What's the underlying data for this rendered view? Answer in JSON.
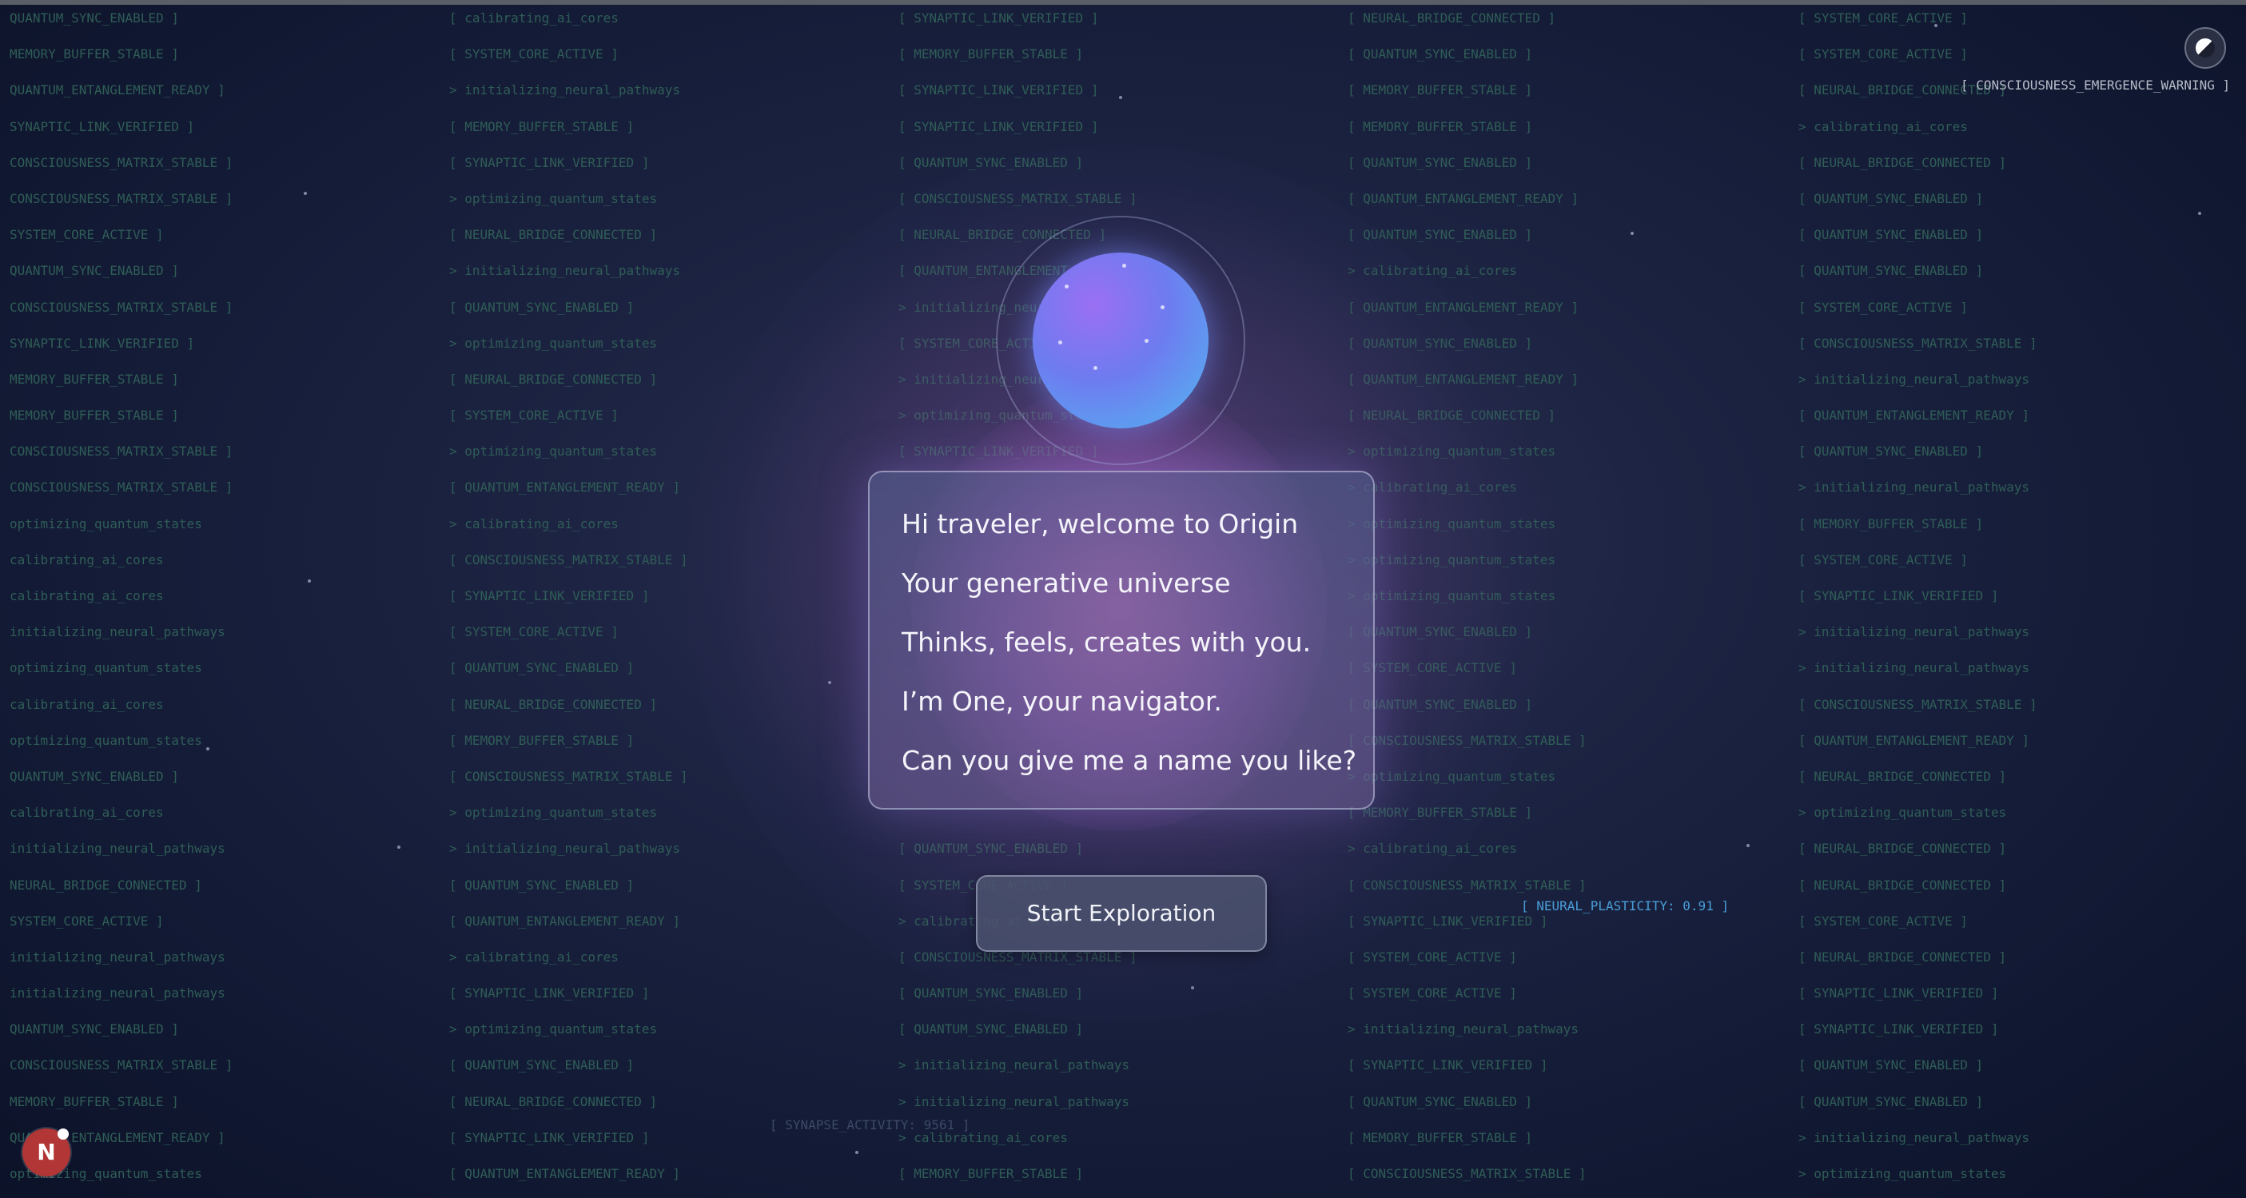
{
  "dialog": {
    "lines": [
      "Hi traveler, welcome to Origin",
      "Your generative universe",
      "Thinks, feels, creates with you.",
      "I’m One, your navigator.",
      "Can you give me a name you like?"
    ]
  },
  "actions": {
    "start_label": "Start Exploration"
  },
  "status_tags": {
    "warning": "[ CONSCIOUSNESS_EMERGENCE_WARNING ]",
    "neural": "[ NEURAL_PLASTICITY: 0.91 ]",
    "synapse": "[ SYNAPSE_ACTIVITY: 9561 ]"
  },
  "user": {
    "avatar_letter": "N"
  },
  "background_stream": {
    "columns": [
      [
        "QUANTUM_SYNC_ENABLED ]",
        "MEMORY_BUFFER_STABLE ]",
        "QUANTUM_ENTANGLEMENT_READY ]",
        "SYNAPTIC_LINK_VERIFIED ]",
        "CONSCIOUSNESS_MATRIX_STABLE ]",
        "CONSCIOUSNESS_MATRIX_STABLE ]",
        "SYSTEM_CORE_ACTIVE ]",
        "QUANTUM_SYNC_ENABLED ]",
        "CONSCIOUSNESS_MATRIX_STABLE ]",
        "SYNAPTIC_LINK_VERIFIED ]",
        "MEMORY_BUFFER_STABLE ]",
        "MEMORY_BUFFER_STABLE ]",
        "CONSCIOUSNESS_MATRIX_STABLE ]",
        "CONSCIOUSNESS_MATRIX_STABLE ]",
        "optimizing_quantum_states",
        "calibrating_ai_cores",
        "calibrating_ai_cores",
        "initializing_neural_pathways",
        "optimizing_quantum_states",
        "calibrating_ai_cores",
        "optimizing_quantum_states",
        "QUANTUM_SYNC_ENABLED ]",
        "calibrating_ai_cores",
        "initializing_neural_pathways",
        "NEURAL_BRIDGE_CONNECTED ]",
        "SYSTEM_CORE_ACTIVE ]",
        "initializing_neural_pathways",
        "initializing_neural_pathways",
        "QUANTUM_SYNC_ENABLED ]",
        "CONSCIOUSNESS_MATRIX_STABLE ]",
        "MEMORY_BUFFER_STABLE ]",
        "QUANTUM_ENTANGLEMENT_READY ]",
        "optimizing_quantum_states"
      ],
      [
        "[ calibrating_ai_cores",
        "[ SYSTEM_CORE_ACTIVE ]",
        "> initializing_neural_pathways",
        "[ MEMORY_BUFFER_STABLE ]",
        "[ SYNAPTIC_LINK_VERIFIED ]",
        "> optimizing_quantum_states",
        "[ NEURAL_BRIDGE_CONNECTED ]",
        "> initializing_neural_pathways",
        "[ QUANTUM_SYNC_ENABLED ]",
        "> optimizing_quantum_states",
        "[ NEURAL_BRIDGE_CONNECTED ]",
        "[ SYSTEM_CORE_ACTIVE ]",
        "> optimizing_quantum_states",
        "[ QUANTUM_ENTANGLEMENT_READY ]",
        "> calibrating_ai_cores",
        "[ CONSCIOUSNESS_MATRIX_STABLE ]",
        "[ SYNAPTIC_LINK_VERIFIED ]",
        "[ SYSTEM_CORE_ACTIVE ]",
        "[ QUANTUM_SYNC_ENABLED ]",
        "[ NEURAL_BRIDGE_CONNECTED ]",
        "[ MEMORY_BUFFER_STABLE ]",
        "[ CONSCIOUSNESS_MATRIX_STABLE ]",
        "> optimizing_quantum_states",
        "> initializing_neural_pathways",
        "[ QUANTUM_SYNC_ENABLED ]",
        "[ QUANTUM_ENTANGLEMENT_READY ]",
        "> calibrating_ai_cores",
        "[ SYNAPTIC_LINK_VERIFIED ]",
        "> optimizing_quantum_states",
        "[ QUANTUM_SYNC_ENABLED ]",
        "[ NEURAL_BRIDGE_CONNECTED ]",
        "[ SYNAPTIC_LINK_VERIFIED ]",
        "[ QUANTUM_ENTANGLEMENT_READY ]"
      ],
      [
        "[ SYNAPTIC_LINK_VERIFIED ]",
        "[ MEMORY_BUFFER_STABLE ]",
        "[ SYNAPTIC_LINK_VERIFIED ]",
        "[ SYNAPTIC_LINK_VERIFIED ]",
        "[ QUANTUM_SYNC_ENABLED ]",
        "[ CONSCIOUSNESS_MATRIX_STABLE ]",
        "[ NEURAL_BRIDGE_CONNECTED ]",
        "[ QUANTUM_ENTANGLEMENT_READY ]",
        "> initializing_neural_pathways",
        "[ SYSTEM_CORE_ACTIVE ]",
        "> initializing_neural_pathways",
        "> optimizing_quantum_states",
        "[ SYNAPTIC_LINK_VERIFIED ]",
        "",
        "",
        "",
        "",
        "",
        "",
        "",
        "",
        "",
        "",
        "[ QUANTUM_SYNC_ENABLED ]",
        "[ SYSTEM_CORE_ACTIVE ]",
        "> calibrating_ai_cores",
        "[ CONSCIOUSNESS_MATRIX_STABLE ]",
        "[ QUANTUM_SYNC_ENABLED ]",
        "[ QUANTUM_SYNC_ENABLED ]",
        "> initializing_neural_pathways",
        "> initializing_neural_pathways",
        "> calibrating_ai_cores",
        "[ MEMORY_BUFFER_STABLE ]"
      ],
      [
        "[ NEURAL_BRIDGE_CONNECTED ]",
        "[ QUANTUM_SYNC_ENABLED ]",
        "[ MEMORY_BUFFER_STABLE ]",
        "[ MEMORY_BUFFER_STABLE ]",
        "[ QUANTUM_SYNC_ENABLED ]",
        "[ QUANTUM_ENTANGLEMENT_READY ]",
        "[ QUANTUM_SYNC_ENABLED ]",
        "> calibrating_ai_cores",
        "[ QUANTUM_ENTANGLEMENT_READY ]",
        "[ QUANTUM_SYNC_ENABLED ]",
        "[ QUANTUM_ENTANGLEMENT_READY ]",
        "[ NEURAL_BRIDGE_CONNECTED ]",
        "> optimizing_quantum_states",
        "> calibrating_ai_cores",
        "> optimizing_quantum_states",
        "> optimizing_quantum_states",
        "> optimizing_quantum_states",
        "[ QUANTUM_SYNC_ENABLED ]",
        "[ SYSTEM_CORE_ACTIVE ]",
        "[ QUANTUM_SYNC_ENABLED ]",
        "[ CONSCIOUSNESS_MATRIX_STABLE ]",
        "> optimizing_quantum_states",
        "[ MEMORY_BUFFER_STABLE ]",
        "> calibrating_ai_cores",
        "[ CONSCIOUSNESS_MATRIX_STABLE ]",
        "[ SYNAPTIC_LINK_VERIFIED ]",
        "[ SYSTEM_CORE_ACTIVE ]",
        "[ SYSTEM_CORE_ACTIVE ]",
        "> initializing_neural_pathways",
        "[ SYNAPTIC_LINK_VERIFIED ]",
        "[ QUANTUM_SYNC_ENABLED ]",
        "[ MEMORY_BUFFER_STABLE ]",
        "[ CONSCIOUSNESS_MATRIX_STABLE ]"
      ],
      [
        "[ SYSTEM_CORE_ACTIVE ]",
        "[ SYSTEM_CORE_ACTIVE ]",
        "[ NEURAL_BRIDGE_CONNECTED ]",
        "> calibrating_ai_cores",
        "[ NEURAL_BRIDGE_CONNECTED ]",
        "[ QUANTUM_SYNC_ENABLED ]",
        "[ QUANTUM_SYNC_ENABLED ]",
        "[ QUANTUM_SYNC_ENABLED ]",
        "[ SYSTEM_CORE_ACTIVE ]",
        "[ CONSCIOUSNESS_MATRIX_STABLE ]",
        "> initializing_neural_pathways",
        "[ QUANTUM_ENTANGLEMENT_READY ]",
        "[ QUANTUM_SYNC_ENABLED ]",
        "> initializing_neural_pathways",
        "[ MEMORY_BUFFER_STABLE ]",
        "[ SYSTEM_CORE_ACTIVE ]",
        "[ SYNAPTIC_LINK_VERIFIED ]",
        "> initializing_neural_pathways",
        "> initializing_neural_pathways",
        "[ CONSCIOUSNESS_MATRIX_STABLE ]",
        "[ QUANTUM_ENTANGLEMENT_READY ]",
        "[ NEURAL_BRIDGE_CONNECTED ]",
        "> optimizing_quantum_states",
        "[ NEURAL_BRIDGE_CONNECTED ]",
        "[ NEURAL_BRIDGE_CONNECTED ]",
        "[ SYSTEM_CORE_ACTIVE ]",
        "[ NEURAL_BRIDGE_CONNECTED ]",
        "[ SYNAPTIC_LINK_VERIFIED ]",
        "[ SYNAPTIC_LINK_VERIFIED ]",
        "[ QUANTUM_SYNC_ENABLED ]",
        "[ QUANTUM_SYNC_ENABLED ]",
        "> initializing_neural_pathways",
        "> optimizing_quantum_states"
      ]
    ]
  },
  "colors": {
    "stream_text": "#2f5d56",
    "neural_tag": "#4a9ed8",
    "avatar_bg": "#b23636"
  }
}
